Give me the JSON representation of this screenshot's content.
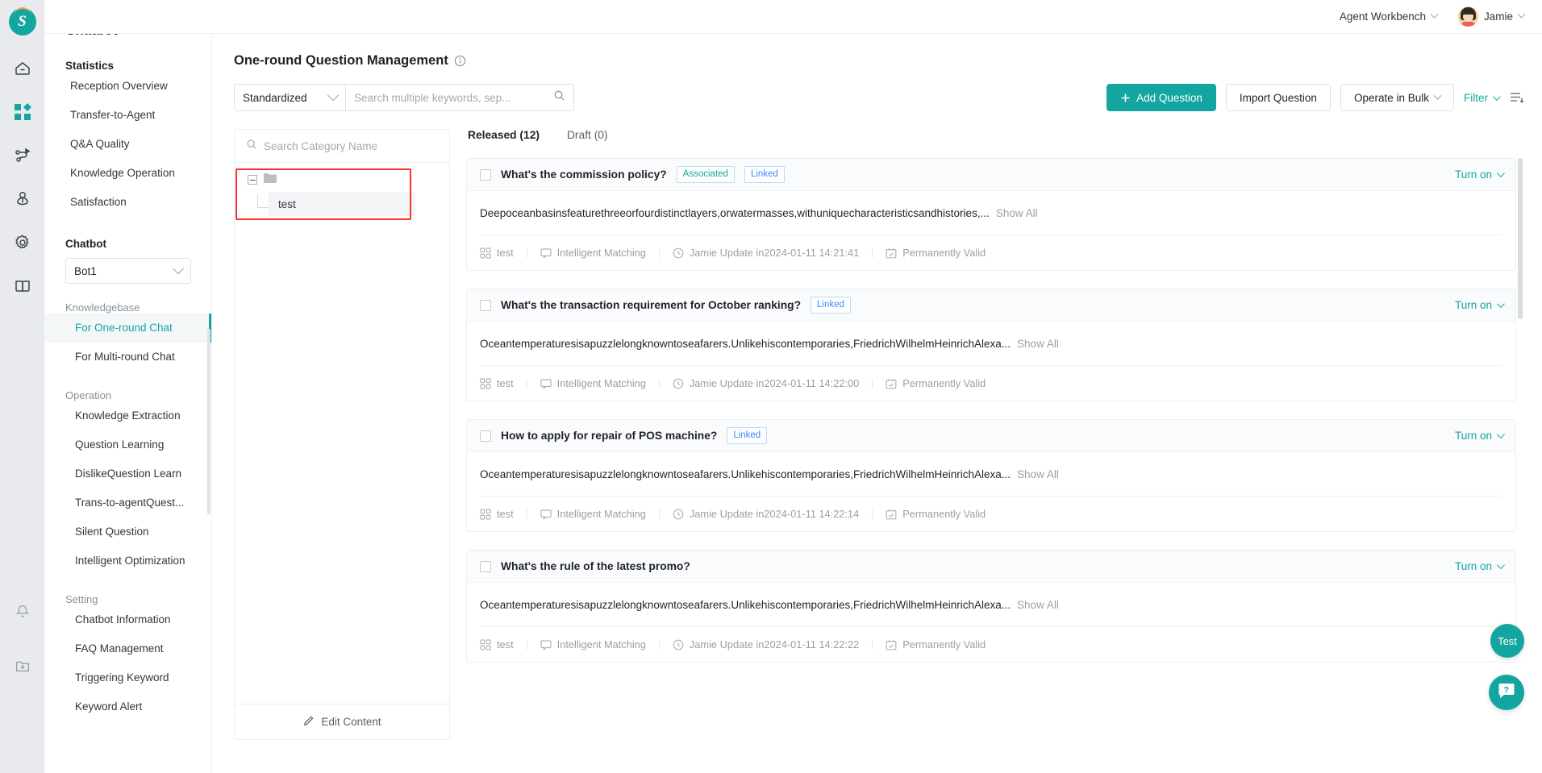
{
  "topbar": {
    "workbench_label": "Agent Workbench",
    "user_name": "Jamie"
  },
  "rail": {
    "logo_letter": "S",
    "icons": [
      "home-icon",
      "apps-grid-icon",
      "flow-route-icon",
      "user-locate-icon",
      "gear-icon",
      "book-icon"
    ],
    "bottom_icons": [
      "bell-icon",
      "download-folder-icon"
    ]
  },
  "sidebar": {
    "title": "Chatbot",
    "groups": [
      {
        "label": "Statistics",
        "bold": true,
        "items": [
          "Reception Overview",
          "Transfer-to-Agent",
          "Q&A Quality",
          "Knowledge Operation",
          "Satisfaction"
        ]
      }
    ],
    "chatbot_label": "Chatbot",
    "chatbot_select_value": "Bot1",
    "knowledgebase_label": "Knowledgebase",
    "knowledgebase_items": [
      "For One-round Chat",
      "For Multi-round Chat"
    ],
    "active_item": "For One-round Chat",
    "operation_label": "Operation",
    "operation_items": [
      "Knowledge Extraction",
      "Question Learning",
      "DislikeQuestion Learn",
      "Trans-to-agentQuest...",
      "Silent Question",
      "Intelligent Optimization"
    ],
    "setting_label": "Setting",
    "setting_items": [
      "Chatbot Information",
      "FAQ Management",
      "Triggering Keyword",
      "Keyword Alert"
    ]
  },
  "page": {
    "title": "One-round Question Management",
    "info_icon": "info-circle-icon"
  },
  "toolbar": {
    "type_select_value": "Standardized",
    "search_placeholder": "Search multiple keywords, sep...",
    "search_value": "",
    "add_question_label": "Add Question",
    "import_question_label": "Import Question",
    "operate_bulk_label": "Operate in Bulk",
    "filter_label": "Filter",
    "sort_icon": "sort-list-icon",
    "accent_color": "#13a6a0"
  },
  "category_panel": {
    "search_placeholder": "Search Category Name",
    "search_value": "",
    "tree_root_icon": "folder-icon",
    "tree_child_label": "test",
    "highlight_color": "#f4352c",
    "edit_content_label": "Edit Content",
    "edit_icon": "pencil-icon"
  },
  "tabs": [
    {
      "label": "Released (12)",
      "active": true
    },
    {
      "label": "Draft (0)",
      "active": false
    }
  ],
  "cards": [
    {
      "question": "What's the commission policy?",
      "badges": [
        {
          "text": "Associated",
          "color": "teal"
        },
        {
          "text": "Linked",
          "color": "blue"
        }
      ],
      "toggle_label": "Turn on",
      "answer": "Deepoceanbasinsfeaturethreeorfourdistinctlayers,orwatermasses,withuniquecharacteristicsandhistories,...",
      "show_all_label": "Show All",
      "meta": {
        "category": "test",
        "matching": "Intelligent Matching",
        "updater": "Jamie  Update in2024-01-11 14:21:41",
        "validity": "Permanently Valid"
      }
    },
    {
      "question": "What's the transaction requirement for October ranking?",
      "badges": [
        {
          "text": "Linked",
          "color": "blue"
        }
      ],
      "toggle_label": "Turn on",
      "answer": "Oceantemperaturesisapuzzlelongknowntoseafarers.Unlikehiscontemporaries,FriedrichWilhelmHeinrichAlexa...",
      "show_all_label": "Show All",
      "meta": {
        "category": "test",
        "matching": "Intelligent Matching",
        "updater": "Jamie  Update in2024-01-11 14:22:00",
        "validity": "Permanently Valid"
      }
    },
    {
      "question": "How to apply for repair of POS machine?",
      "badges": [
        {
          "text": "Linked",
          "color": "blue"
        }
      ],
      "toggle_label": "Turn on",
      "answer": "Oceantemperaturesisapuzzlelongknowntoseafarers.Unlikehiscontemporaries,FriedrichWilhelmHeinrichAlexa...",
      "show_all_label": "Show All",
      "meta": {
        "category": "test",
        "matching": "Intelligent Matching",
        "updater": "Jamie  Update in2024-01-11 14:22:14",
        "validity": "Permanently Valid"
      }
    },
    {
      "question": "What's the rule of the latest promo?",
      "badges": [],
      "toggle_label": "Turn on",
      "answer": "Oceantemperaturesisapuzzlelongknowntoseafarers.Unlikehiscontemporaries,FriedrichWilhelmHeinrichAlexa...",
      "show_all_label": "Show All",
      "meta": {
        "category": "test",
        "matching": "Intelligent Matching",
        "updater": "Jamie  Update in2024-01-11 14:22:22",
        "validity": "Permanently Valid"
      }
    }
  ],
  "floating": {
    "test_label": "Test",
    "help_icon": "question-bubble-icon"
  }
}
